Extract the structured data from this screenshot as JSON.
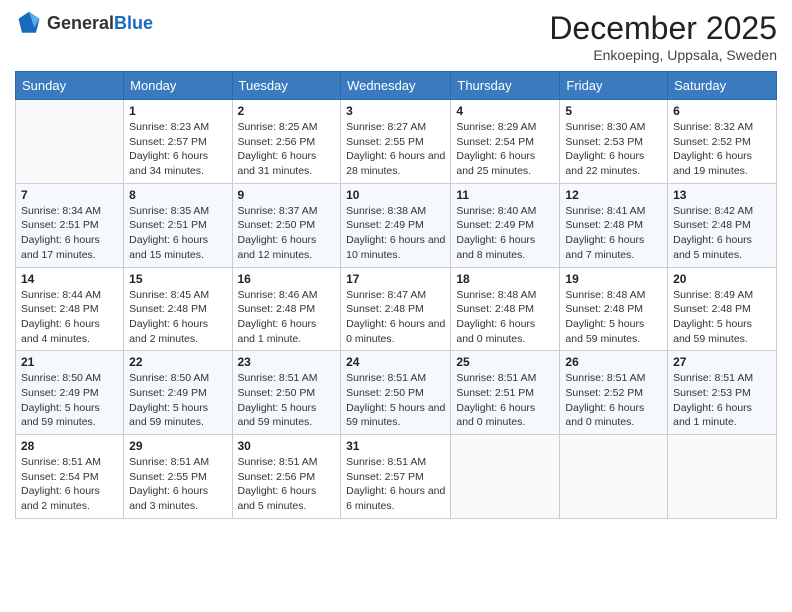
{
  "header": {
    "logo_general": "General",
    "logo_blue": "Blue",
    "month": "December 2025",
    "location": "Enkoeping, Uppsala, Sweden"
  },
  "weekdays": [
    "Sunday",
    "Monday",
    "Tuesday",
    "Wednesday",
    "Thursday",
    "Friday",
    "Saturday"
  ],
  "weeks": [
    [
      {
        "day": "",
        "sunrise": "",
        "sunset": "",
        "daylight": ""
      },
      {
        "day": "1",
        "sunrise": "Sunrise: 8:23 AM",
        "sunset": "Sunset: 2:57 PM",
        "daylight": "Daylight: 6 hours and 34 minutes."
      },
      {
        "day": "2",
        "sunrise": "Sunrise: 8:25 AM",
        "sunset": "Sunset: 2:56 PM",
        "daylight": "Daylight: 6 hours and 31 minutes."
      },
      {
        "day": "3",
        "sunrise": "Sunrise: 8:27 AM",
        "sunset": "Sunset: 2:55 PM",
        "daylight": "Daylight: 6 hours and 28 minutes."
      },
      {
        "day": "4",
        "sunrise": "Sunrise: 8:29 AM",
        "sunset": "Sunset: 2:54 PM",
        "daylight": "Daylight: 6 hours and 25 minutes."
      },
      {
        "day": "5",
        "sunrise": "Sunrise: 8:30 AM",
        "sunset": "Sunset: 2:53 PM",
        "daylight": "Daylight: 6 hours and 22 minutes."
      },
      {
        "day": "6",
        "sunrise": "Sunrise: 8:32 AM",
        "sunset": "Sunset: 2:52 PM",
        "daylight": "Daylight: 6 hours and 19 minutes."
      }
    ],
    [
      {
        "day": "7",
        "sunrise": "Sunrise: 8:34 AM",
        "sunset": "Sunset: 2:51 PM",
        "daylight": "Daylight: 6 hours and 17 minutes."
      },
      {
        "day": "8",
        "sunrise": "Sunrise: 8:35 AM",
        "sunset": "Sunset: 2:51 PM",
        "daylight": "Daylight: 6 hours and 15 minutes."
      },
      {
        "day": "9",
        "sunrise": "Sunrise: 8:37 AM",
        "sunset": "Sunset: 2:50 PM",
        "daylight": "Daylight: 6 hours and 12 minutes."
      },
      {
        "day": "10",
        "sunrise": "Sunrise: 8:38 AM",
        "sunset": "Sunset: 2:49 PM",
        "daylight": "Daylight: 6 hours and 10 minutes."
      },
      {
        "day": "11",
        "sunrise": "Sunrise: 8:40 AM",
        "sunset": "Sunset: 2:49 PM",
        "daylight": "Daylight: 6 hours and 8 minutes."
      },
      {
        "day": "12",
        "sunrise": "Sunrise: 8:41 AM",
        "sunset": "Sunset: 2:48 PM",
        "daylight": "Daylight: 6 hours and 7 minutes."
      },
      {
        "day": "13",
        "sunrise": "Sunrise: 8:42 AM",
        "sunset": "Sunset: 2:48 PM",
        "daylight": "Daylight: 6 hours and 5 minutes."
      }
    ],
    [
      {
        "day": "14",
        "sunrise": "Sunrise: 8:44 AM",
        "sunset": "Sunset: 2:48 PM",
        "daylight": "Daylight: 6 hours and 4 minutes."
      },
      {
        "day": "15",
        "sunrise": "Sunrise: 8:45 AM",
        "sunset": "Sunset: 2:48 PM",
        "daylight": "Daylight: 6 hours and 2 minutes."
      },
      {
        "day": "16",
        "sunrise": "Sunrise: 8:46 AM",
        "sunset": "Sunset: 2:48 PM",
        "daylight": "Daylight: 6 hours and 1 minute."
      },
      {
        "day": "17",
        "sunrise": "Sunrise: 8:47 AM",
        "sunset": "Sunset: 2:48 PM",
        "daylight": "Daylight: 6 hours and 0 minutes."
      },
      {
        "day": "18",
        "sunrise": "Sunrise: 8:48 AM",
        "sunset": "Sunset: 2:48 PM",
        "daylight": "Daylight: 6 hours and 0 minutes."
      },
      {
        "day": "19",
        "sunrise": "Sunrise: 8:48 AM",
        "sunset": "Sunset: 2:48 PM",
        "daylight": "Daylight: 5 hours and 59 minutes."
      },
      {
        "day": "20",
        "sunrise": "Sunrise: 8:49 AM",
        "sunset": "Sunset: 2:48 PM",
        "daylight": "Daylight: 5 hours and 59 minutes."
      }
    ],
    [
      {
        "day": "21",
        "sunrise": "Sunrise: 8:50 AM",
        "sunset": "Sunset: 2:49 PM",
        "daylight": "Daylight: 5 hours and 59 minutes."
      },
      {
        "day": "22",
        "sunrise": "Sunrise: 8:50 AM",
        "sunset": "Sunset: 2:49 PM",
        "daylight": "Daylight: 5 hours and 59 minutes."
      },
      {
        "day": "23",
        "sunrise": "Sunrise: 8:51 AM",
        "sunset": "Sunset: 2:50 PM",
        "daylight": "Daylight: 5 hours and 59 minutes."
      },
      {
        "day": "24",
        "sunrise": "Sunrise: 8:51 AM",
        "sunset": "Sunset: 2:50 PM",
        "daylight": "Daylight: 5 hours and 59 minutes."
      },
      {
        "day": "25",
        "sunrise": "Sunrise: 8:51 AM",
        "sunset": "Sunset: 2:51 PM",
        "daylight": "Daylight: 6 hours and 0 minutes."
      },
      {
        "day": "26",
        "sunrise": "Sunrise: 8:51 AM",
        "sunset": "Sunset: 2:52 PM",
        "daylight": "Daylight: 6 hours and 0 minutes."
      },
      {
        "day": "27",
        "sunrise": "Sunrise: 8:51 AM",
        "sunset": "Sunset: 2:53 PM",
        "daylight": "Daylight: 6 hours and 1 minute."
      }
    ],
    [
      {
        "day": "28",
        "sunrise": "Sunrise: 8:51 AM",
        "sunset": "Sunset: 2:54 PM",
        "daylight": "Daylight: 6 hours and 2 minutes."
      },
      {
        "day": "29",
        "sunrise": "Sunrise: 8:51 AM",
        "sunset": "Sunset: 2:55 PM",
        "daylight": "Daylight: 6 hours and 3 minutes."
      },
      {
        "day": "30",
        "sunrise": "Sunrise: 8:51 AM",
        "sunset": "Sunset: 2:56 PM",
        "daylight": "Daylight: 6 hours and 5 minutes."
      },
      {
        "day": "31",
        "sunrise": "Sunrise: 8:51 AM",
        "sunset": "Sunset: 2:57 PM",
        "daylight": "Daylight: 6 hours and 6 minutes."
      },
      {
        "day": "",
        "sunrise": "",
        "sunset": "",
        "daylight": ""
      },
      {
        "day": "",
        "sunrise": "",
        "sunset": "",
        "daylight": ""
      },
      {
        "day": "",
        "sunrise": "",
        "sunset": "",
        "daylight": ""
      }
    ]
  ]
}
